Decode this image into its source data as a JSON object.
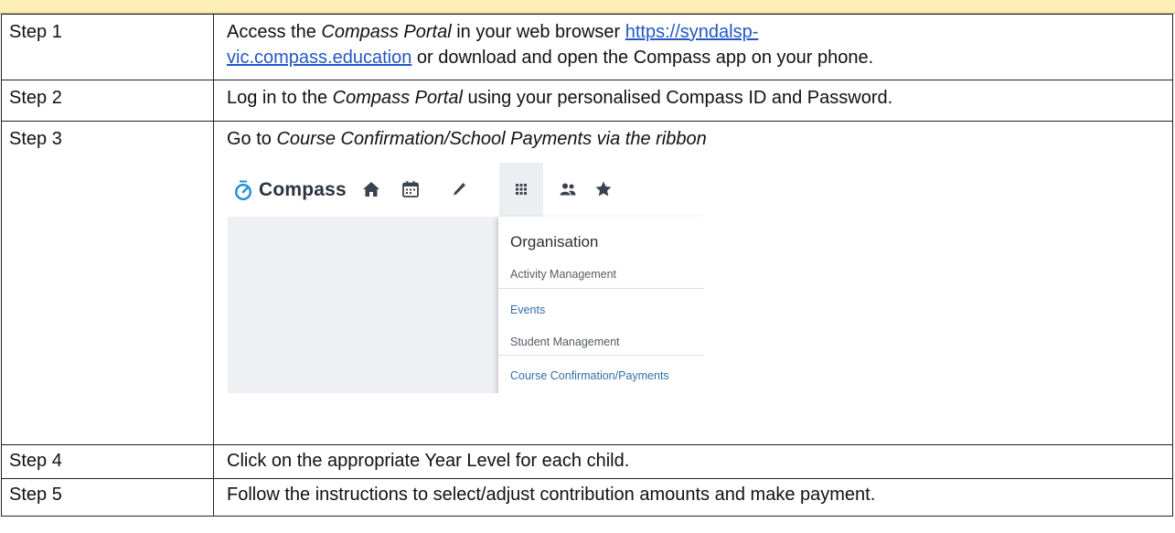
{
  "steps": [
    {
      "label": "Step 1",
      "text_before": "Access the ",
      "emphasis": "Compass Portal",
      "text_middle": " in your web browser ",
      "link_line1": "https://syndalsp-",
      "link_line2": "vic.compass.education",
      "text_after": " or download and open the Compass app on your phone."
    },
    {
      "label": "Step 2",
      "text_before": "Log in to the ",
      "emphasis": "Compass Portal",
      "text_after": " using your personalised Compass ID and Password."
    },
    {
      "label": "Step 3",
      "text_before": "Go to ",
      "emphasis": "Course Confirmation/School Payments via the ribbon"
    },
    {
      "label": "Step 4",
      "text": "Click on the appropriate Year Level for each child."
    },
    {
      "label": "Step 5",
      "text": "Follow the instructions to select/adjust contribution amounts and make payment."
    }
  ],
  "compass": {
    "brand": "Compass",
    "nav_icons": [
      "home-icon",
      "calendar-icon",
      "pencil-icon",
      "apps-grid-icon",
      "people-icon",
      "star-icon"
    ],
    "menu": {
      "title": "Organisation",
      "section1": "Activity Management",
      "item1": "Events",
      "section2": "Student Management",
      "item2": "Course Confirmation/Payments"
    }
  },
  "colors": {
    "header_bar": "#fdeeb5",
    "link": "#2357c5",
    "compass_blue": "#1f8ed6",
    "menu_link": "#2f6fae"
  }
}
